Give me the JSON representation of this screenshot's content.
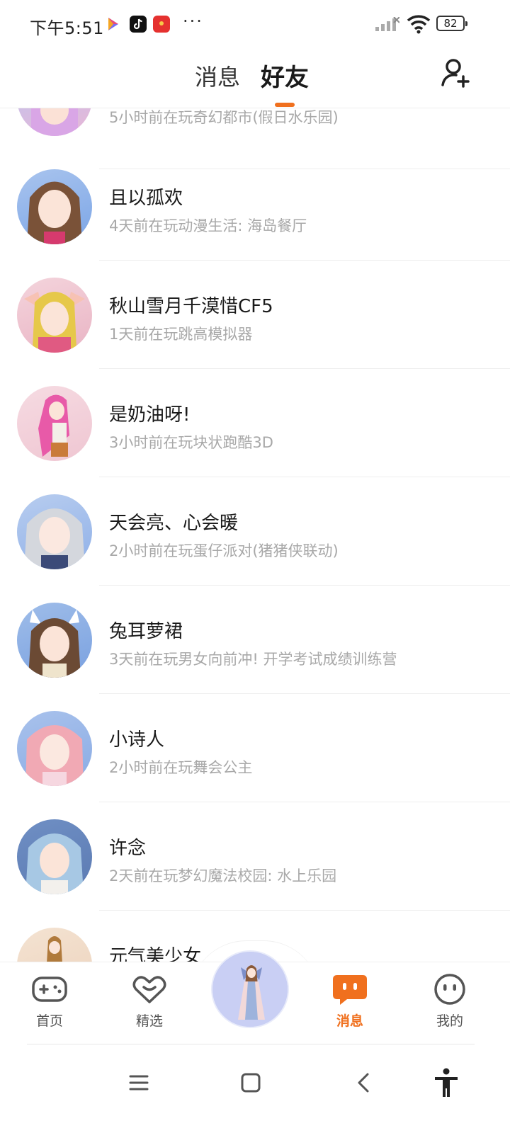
{
  "status_bar": {
    "time": "下午5:51",
    "more": "···",
    "battery": "82"
  },
  "header": {
    "tabs": [
      {
        "label": "消息",
        "active": false
      },
      {
        "label": "好友",
        "active": true
      }
    ],
    "accent_color": "#f0701e",
    "add_friend_icon": "add-user-icon"
  },
  "friends": [
    {
      "name": "",
      "status": "5小时前在玩奇幻都市(假日水乐园)"
    },
    {
      "name": "且以孤欢",
      "status": "4天前在玩动漫生活: 海岛餐厅"
    },
    {
      "name": "秋山雪月千漠惜CF5",
      "status": "1天前在玩跳高模拟器"
    },
    {
      "name": "是奶油呀!",
      "status": "3小时前在玩块状跑酷3D"
    },
    {
      "name": "天会亮、心会暖",
      "status": "2小时前在玩蛋仔派对(猪猪侠联动)"
    },
    {
      "name": "兔耳萝裙",
      "status": "3天前在玩男女向前冲! 开学考试成绩训练营"
    },
    {
      "name": "小诗人",
      "status": "2小时前在玩舞会公主"
    },
    {
      "name": "许念",
      "status": "2天前在玩梦幻魔法校园: 水上乐园"
    },
    {
      "name": "元气美少女",
      "status": ""
    }
  ],
  "bottom_nav": {
    "items": [
      {
        "label": "首页",
        "icon": "gamepad-icon",
        "active": false
      },
      {
        "label": "精选",
        "icon": "heart-icon",
        "active": false
      },
      {
        "label": "消息",
        "icon": "chat-icon",
        "active": true
      },
      {
        "label": "我的",
        "icon": "face-icon",
        "active": false
      }
    ],
    "center_icon": "avatar-character-icon"
  },
  "system_nav": [
    "menu-icon",
    "home-icon",
    "back-icon",
    "accessibility-icon"
  ]
}
